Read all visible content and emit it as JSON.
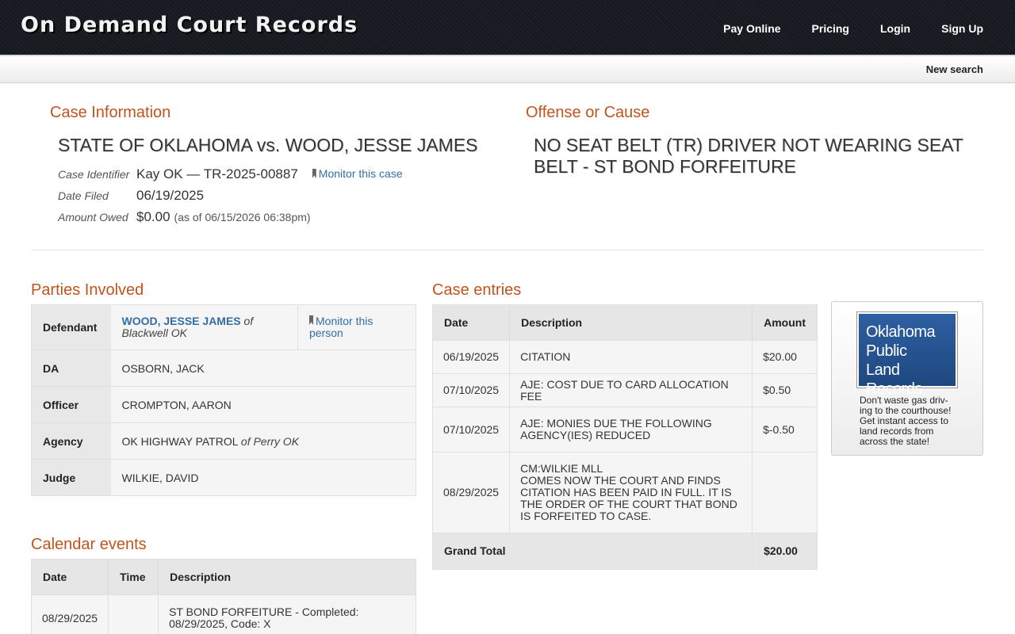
{
  "header": {
    "brand": "On Demand Court Records",
    "nav": [
      {
        "label": "Pay Online"
      },
      {
        "label": "Pricing"
      },
      {
        "label": "Login"
      },
      {
        "label": "Sign Up"
      }
    ],
    "new_search": "New search"
  },
  "case_info": {
    "heading": "Case Information",
    "title": "STATE OF OKLAHOMA vs. WOOD, JESSE JAMES",
    "identifier_label": "Case Identifier",
    "identifier": "Kay OK — TR-2025-00887",
    "monitor_case": "Monitor this case",
    "date_filed_label": "Date Filed",
    "date_filed": "06/19/2025",
    "amount_owed_label": "Amount Owed",
    "amount_owed": "$0.00",
    "amount_note": "(as of 06/15/2026 06:38pm)"
  },
  "offense": {
    "heading": "Offense or Cause",
    "text": "NO SEAT BELT (TR) DRIVER NOT WEARING SEAT BELT - ST BOND FORFEITURE"
  },
  "parties": {
    "heading": "Parties Involved",
    "defendant_label": "Defendant",
    "defendant_name": "WOOD, JESSE JAMES",
    "defendant_of": "of",
    "defendant_location": "Blackwell OK",
    "monitor_person": "Monitor this person",
    "rows": [
      {
        "label": "DA",
        "value": "OSBORN, JACK",
        "location": ""
      },
      {
        "label": "Officer",
        "value": "CROMPTON, AARON",
        "location": ""
      },
      {
        "label": "Agency",
        "value": "OK HIGHWAY PATROL",
        "location": "of Perry OK"
      },
      {
        "label": "Judge",
        "value": "WILKIE, DAVID",
        "location": ""
      }
    ]
  },
  "calendar": {
    "heading": "Calendar events",
    "columns": [
      "Date",
      "Time",
      "Description"
    ],
    "rows": [
      {
        "date": "08/29/2025",
        "time": "",
        "description": "ST BOND FORFEITURE - Completed: 08/29/2025, Code: X"
      }
    ]
  },
  "entries": {
    "heading": "Case entries",
    "columns": [
      "Date",
      "Description",
      "Amount"
    ],
    "rows": [
      {
        "date": "06/19/2025",
        "description": "CITATION",
        "amount": "$20.00"
      },
      {
        "date": "07/10/2025",
        "description": "AJE: COST DUE TO CARD ALLOCATION FEE",
        "amount": "$0.50"
      },
      {
        "date": "07/10/2025",
        "description": "AJE: MONIES DUE THE FOLLOWING AGENCY(IES) REDUCED",
        "amount": "$-0.50"
      },
      {
        "date": "08/29/2025",
        "description_lines": [
          "CM:WILKIE MLL",
          "COMES NOW THE COURT AND FINDS CITATION HAS BEEN PAID IN FULL. IT IS THE ORDER OF THE COURT THAT BOND IS FORFEITED TO CASE."
        ],
        "amount": ""
      }
    ],
    "total_label": "Grand Total",
    "total": "$20.00"
  },
  "ad": {
    "logo_lines": [
      "Oklahoma",
      "Public",
      "Land Records"
    ],
    "text": "Don't waste gas driv-ing to the courthouse! Get instant access to land records from across the state!",
    "logo_color": "#2d5fa1"
  }
}
